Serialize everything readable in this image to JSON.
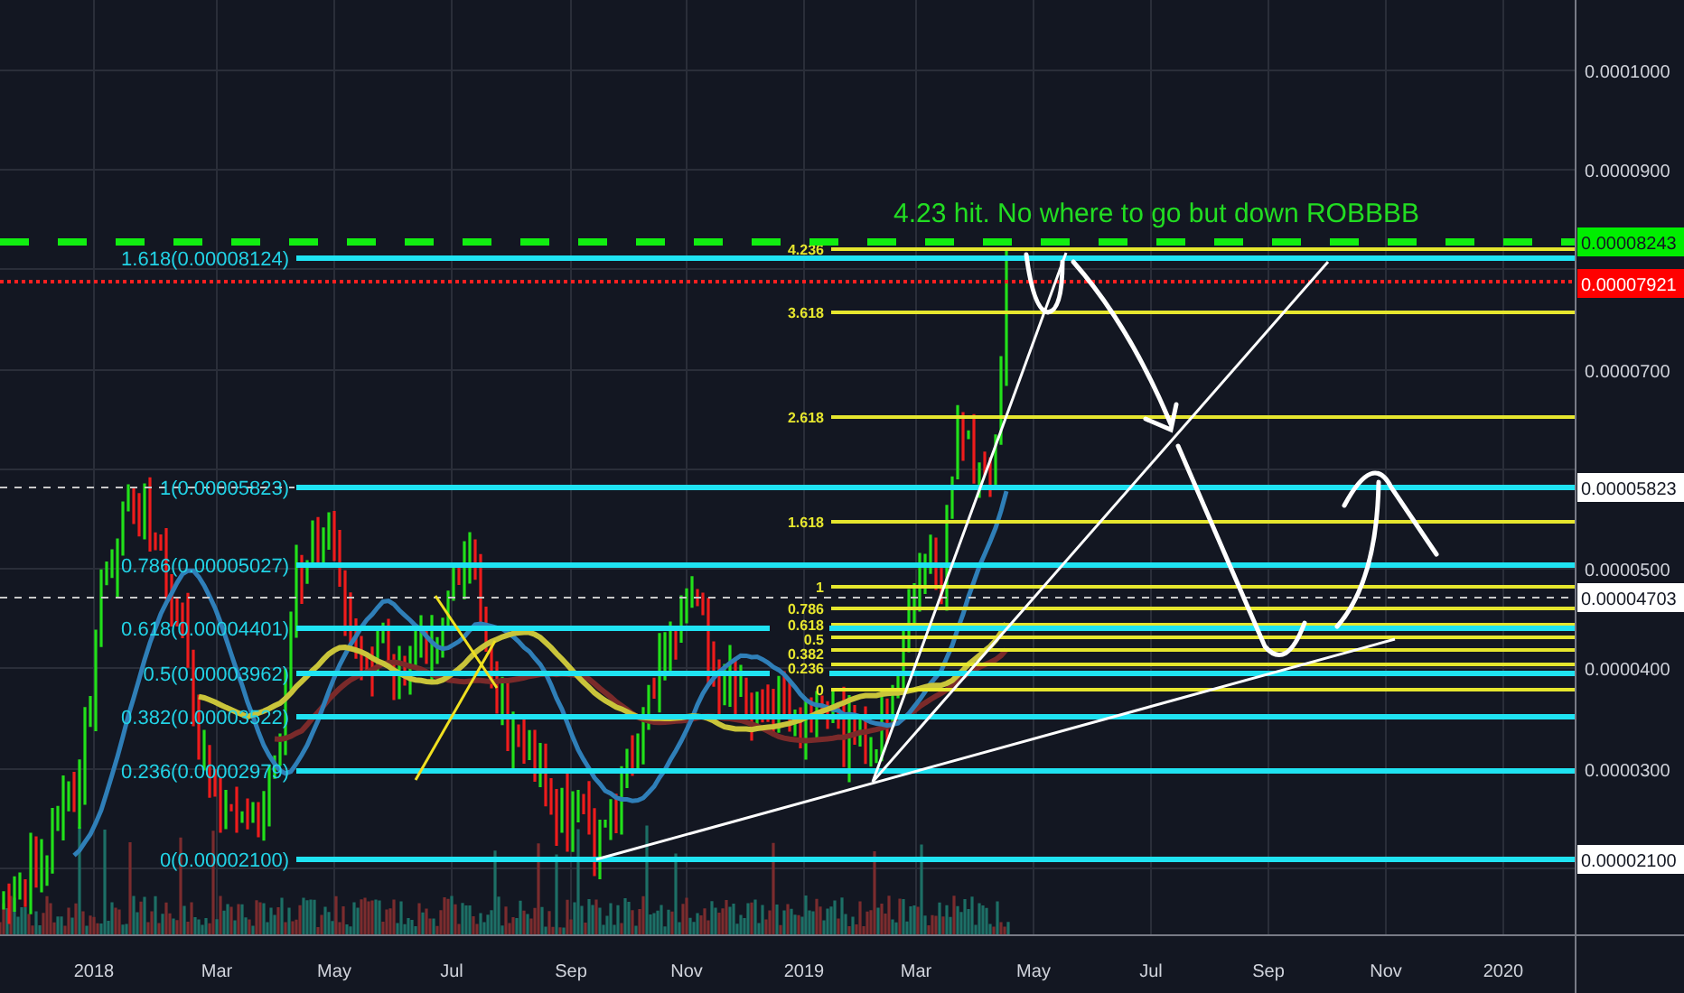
{
  "annotation": {
    "text": "4.23 hit. No where to go but down ROBBBB"
  },
  "fib_retracement": {
    "levels": [
      {
        "label": "1.618(0.00008124)"
      },
      {
        "label": "1(0.00005823)"
      },
      {
        "label": "0.786(0.00005027)"
      },
      {
        "label": "0.618(0.00004401)"
      },
      {
        "label": "0.5(0.00003962)"
      },
      {
        "label": "0.382(0.00003522)"
      },
      {
        "label": "0.236(0.00002979)"
      },
      {
        "label": "0(0.00002100)"
      }
    ]
  },
  "fib_extension": {
    "levels": [
      {
        "label": "4.236"
      },
      {
        "label": "3.618"
      },
      {
        "label": "2.618"
      },
      {
        "label": "1.618"
      },
      {
        "label": "1"
      },
      {
        "label": "0.786"
      },
      {
        "label": "0.618"
      },
      {
        "label": "0.5"
      },
      {
        "label": "0.382"
      },
      {
        "label": "0.236"
      },
      {
        "label": "0"
      }
    ]
  },
  "price_axis": {
    "ticks": [
      "0.0001000",
      "0.0000900",
      "0.0000700",
      "0.0000500",
      "0.0000400",
      "0.0000300"
    ],
    "badges": [
      {
        "text": "0.00008243",
        "color": "#00ee00"
      },
      {
        "text": "0.00007921",
        "color": "#ff0000"
      },
      {
        "text": "0.00005823",
        "color": "#ffffff"
      },
      {
        "text": "0.00004703",
        "color": "#ffffff"
      },
      {
        "text": "0.00002100",
        "color": "#ffffff"
      }
    ]
  },
  "time_axis": {
    "labels": [
      "2018",
      "Mar",
      "May",
      "Jul",
      "Sep",
      "Nov",
      "2019",
      "Mar",
      "May",
      "Jul",
      "Sep",
      "Nov",
      "2020"
    ]
  }
}
